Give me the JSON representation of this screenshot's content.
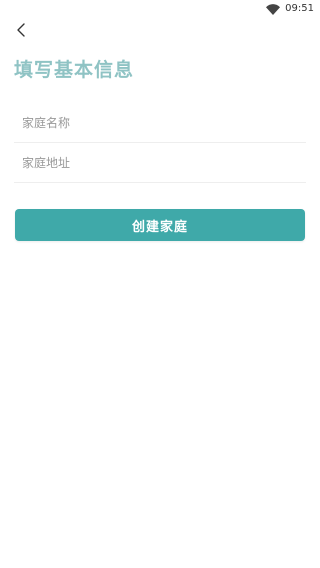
{
  "status_bar": {
    "time": "09:51",
    "wifi_icon": "wifi-icon"
  },
  "header": {
    "back_icon": "chevron-left-icon",
    "title": "填写基本信息"
  },
  "form": {
    "family_name": {
      "value": "",
      "placeholder": "家庭名称"
    },
    "family_address": {
      "value": "",
      "placeholder": "家庭地址"
    },
    "submit_label": "创建家庭"
  },
  "colors": {
    "title": "#8fc3c4",
    "accent": "#3fa9a9",
    "divider": "#eeeeee",
    "placeholder": "#999999"
  }
}
